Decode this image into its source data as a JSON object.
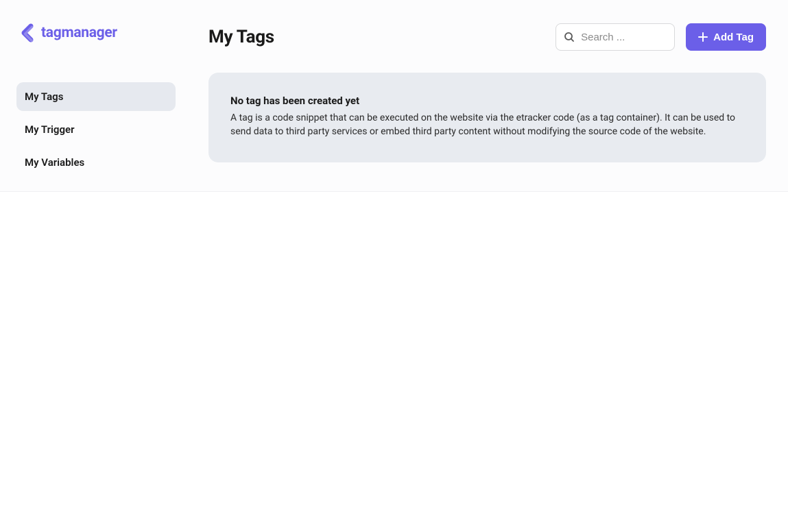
{
  "logo": {
    "text": "tagmanager"
  },
  "sidebar": {
    "items": [
      {
        "label": "My Tags",
        "id": "my-tags",
        "active": true
      },
      {
        "label": "My Trigger",
        "id": "my-trigger",
        "active": false
      },
      {
        "label": "My Variables",
        "id": "my-variables",
        "active": false
      }
    ]
  },
  "header": {
    "title": "My Tags",
    "search_placeholder": "Search ...",
    "add_button_label": "Add Tag"
  },
  "empty_state": {
    "title": "No tag has been created yet",
    "description": "A tag is a code snippet that can be executed on the website via the etracker code (as a tag container). It can be used to send data to third party services or embed third party content without modifying the source code of the website."
  }
}
